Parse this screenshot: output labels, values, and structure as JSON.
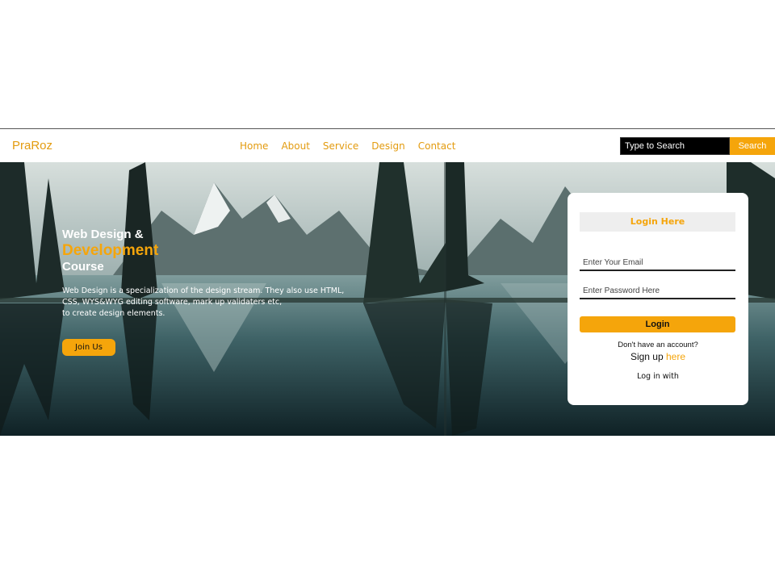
{
  "brand": {
    "logo": "PraRoz"
  },
  "nav": {
    "links": [
      "Home",
      "About",
      "Service",
      "Design",
      "Contact"
    ]
  },
  "search": {
    "placeholder": "Type to Search",
    "button_label": "Search"
  },
  "hero": {
    "title_line1": "Web Design &",
    "title_line2": "Development",
    "title_line3": "Course",
    "description_lines": [
      "Web Design is a specialization of the design stream. They also use HTML,",
      "CSS, WYS&WYG editing software, mark up validaters etc,",
      "to create design elements."
    ],
    "join_button": "Join Us"
  },
  "login": {
    "title": "Login Here",
    "email_placeholder": "Enter Your Email",
    "password_placeholder": "Enter Password Here",
    "button_label": "Login",
    "no_account_text": "Don't have an account?",
    "signup_prefix": "Sign up",
    "signup_link": "here",
    "login_with": "Log in with"
  },
  "colors": {
    "accent": "#f5a50b",
    "search_bg": "#000000",
    "card_bg": "#ffffff"
  }
}
